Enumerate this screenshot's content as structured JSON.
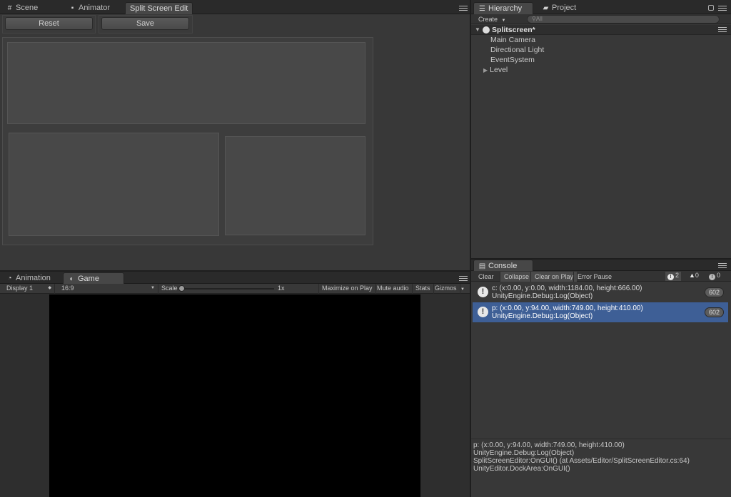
{
  "split_editor": {
    "tabs": [
      {
        "label": "Scene",
        "icon": "grid-icon"
      },
      {
        "label": "Animator",
        "icon": "animator-icon"
      },
      {
        "label": "Split Screen Edit",
        "icon": ""
      }
    ],
    "reset_label": "Reset",
    "save_label": "Save"
  },
  "hierarchy": {
    "tabs": [
      {
        "label": "Hierarchy",
        "icon": "list-icon"
      },
      {
        "label": "Project",
        "icon": "folder-icon"
      }
    ],
    "create_label": "Create",
    "search_placeholder": "All",
    "scene_name": "Splitscreen*",
    "items": [
      {
        "label": "Main Camera"
      },
      {
        "label": "Directional Light"
      },
      {
        "label": "EventSystem"
      },
      {
        "label": "Level"
      }
    ]
  },
  "game": {
    "tabs": [
      {
        "label": "Animation",
        "icon": "animation-icon"
      },
      {
        "label": "Game",
        "icon": "game-icon"
      }
    ],
    "display": "Display 1",
    "aspect": "16:9",
    "scale_label": "Scale",
    "scale_value": "1x",
    "maximize_label": "Maximize on Play",
    "mute_label": "Mute audio",
    "stats_label": "Stats",
    "gizmos_label": "Gizmos"
  },
  "console": {
    "tab_label": "Console",
    "clear_label": "Clear",
    "collapse_label": "Collapse",
    "clear_on_play_label": "Clear on Play",
    "error_pause_label": "Error Pause",
    "info_count": "2",
    "warn_count": "0",
    "error_count": "0",
    "entries": [
      {
        "line1": "c: (x:0.00, y:0.00, width:1184.00, height:666.00)",
        "line2": "UnityEngine.Debug:Log(Object)",
        "count": "602"
      },
      {
        "line1": "p: (x:0.00, y:94.00, width:749.00, height:410.00)",
        "line2": "UnityEngine.Debug:Log(Object)",
        "count": "602"
      }
    ],
    "detail": [
      "p: (x:0.00, y:94.00, width:749.00, height:410.00)",
      "UnityEngine.Debug:Log(Object)",
      "SplitScreenEditor:OnGUI() (at Assets/Editor/SplitScreenEditor.cs:64)",
      "UnityEditor.DockArea:OnGUI()"
    ]
  },
  "colors": {
    "selection": "#3e5f96",
    "panel_bg": "#383838",
    "game_view": "#000000"
  }
}
